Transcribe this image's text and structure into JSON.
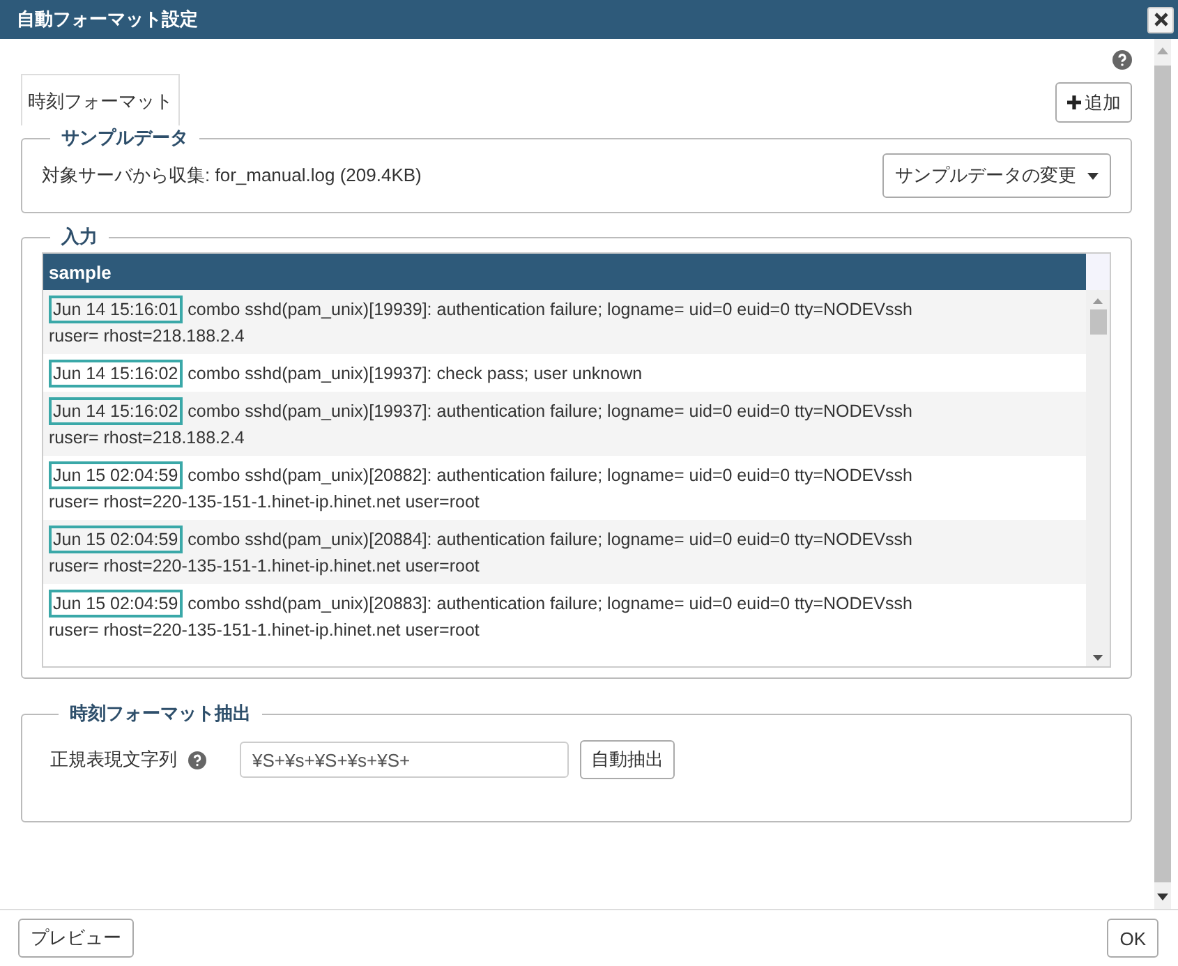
{
  "window": {
    "title": "自動フォーマット設定"
  },
  "tabs": [
    {
      "label": "時刻フォーマット",
      "selected": true
    }
  ],
  "add_button": "追加",
  "sample_data": {
    "legend": "サンプルデータ",
    "source": "対象サーバから収集: for_manual.log (209.4KB)",
    "change_button": "サンプルデータの変更"
  },
  "input": {
    "legend": "入力",
    "table": {
      "columns": [
        "sample"
      ],
      "rows": [
        {
          "timestamp": "Jun 14 15:16:01",
          "message": "combo sshd(pam_unix)[19939]: authentication failure; logname= uid=0 euid=0 tty=NODEVssh",
          "continuation": "ruser= rhost=218.188.2.4"
        },
        {
          "timestamp": "Jun 14 15:16:02",
          "message": "combo sshd(pam_unix)[19937]: check pass; user unknown"
        },
        {
          "timestamp": "Jun 14 15:16:02",
          "message": "combo sshd(pam_unix)[19937]: authentication failure; logname= uid=0 euid=0 tty=NODEVssh",
          "continuation": "ruser= rhost=218.188.2.4"
        },
        {
          "timestamp": "Jun 15 02:04:59",
          "message": "combo sshd(pam_unix)[20882]: authentication failure; logname= uid=0 euid=0 tty=NODEVssh",
          "continuation": "ruser= rhost=220-135-151-1.hinet-ip.hinet.net user=root"
        },
        {
          "timestamp": "Jun 15 02:04:59",
          "message": "combo sshd(pam_unix)[20884]: authentication failure; logname= uid=0 euid=0 tty=NODEVssh",
          "continuation": "ruser= rhost=220-135-151-1.hinet-ip.hinet.net user=root"
        },
        {
          "timestamp": "Jun 15 02:04:59",
          "message": "combo sshd(pam_unix)[20883]: authentication failure; logname= uid=0 euid=0 tty=NODEVssh",
          "continuation": "ruser= rhost=220-135-151-1.hinet-ip.hinet.net user=root"
        }
      ]
    }
  },
  "extraction": {
    "legend": "時刻フォーマット抽出",
    "label": "正規表現文字列",
    "value": "¥S+¥s+¥S+¥s+¥S+",
    "auto_button": "自動抽出"
  },
  "footer": {
    "preview_button": "プレビュー",
    "ok_button": "OK"
  }
}
